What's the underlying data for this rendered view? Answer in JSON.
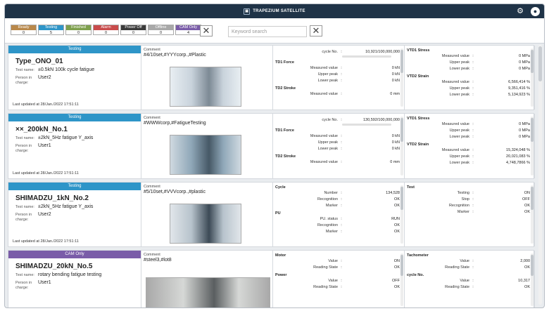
{
  "app": {
    "title": "TRAPEZIUM SATELLITE"
  },
  "filters": [
    {
      "label": "Ready",
      "count": "0",
      "color": "#b9884a"
    },
    {
      "label": "Testing",
      "count": "5",
      "color": "#2e95c8"
    },
    {
      "label": "Finished",
      "count": "0",
      "color": "#7ea04d"
    },
    {
      "label": "Alarm",
      "count": "0",
      "color": "#c94b4b"
    },
    {
      "label": "Power Off",
      "count": "0",
      "color": "#3b3b3b"
    },
    {
      "label": "Offline",
      "count": "0",
      "color": "#a8a8a8"
    },
    {
      "label": "CAM Only",
      "count": "4",
      "color": "#7a5ca8"
    }
  ],
  "search": {
    "placeholder": "Keyword search"
  },
  "cards": [
    {
      "status": "Testing",
      "status_color": "#2e95c8",
      "name": "Type_ONO_01",
      "test_name_label": "Test name:",
      "test_name": "±0.5kN 100k cycle fatigue",
      "person_label": "Person in charge:",
      "person": "User2",
      "updated": "Last updated at  28/Jan./2022 17:51:11",
      "comment_label": "Comment",
      "comment": "#4/10set,#YYYcorp.,#Plastic",
      "m1_sections": [
        {
          "title": "",
          "rows": [
            {
              "name": "cycle No.",
              "value": "10,921/100,000,000"
            }
          ],
          "bar": true
        },
        {
          "title": "TD1 Force",
          "rows": [
            {
              "name": "Measured value",
              "value": "0 kN"
            },
            {
              "name": "Upper peak",
              "value": "0 kN"
            },
            {
              "name": "Lower peak",
              "value": "0 kN"
            }
          ]
        },
        {
          "title": "TD2 Stroke",
          "rows": [
            {
              "name": "Measured value",
              "value": "0 mm"
            }
          ]
        }
      ],
      "m2_sections": [
        {
          "title": "VTD1 Stress",
          "rows": [
            {
              "name": "Measured value",
              "value": "0 MPa"
            },
            {
              "name": "Upper peak",
              "value": "0 MPa"
            },
            {
              "name": "Lower peak",
              "value": "0 MPa"
            }
          ]
        },
        {
          "title": "VTD2 Strain",
          "rows": [
            {
              "name": "Measured value",
              "value": "6,566,414 %"
            },
            {
              "name": "Upper peak",
              "value": "9,351,416 %"
            },
            {
              "name": "Lower peak",
              "value": "5,134,923 %"
            }
          ]
        }
      ]
    },
    {
      "status": "Testing",
      "status_color": "#2e95c8",
      "name": "××_200kN_No.1",
      "test_name_label": "Test name:",
      "test_name": "±2kN_5Hz fatigue Y_axis",
      "person_label": "Person in charge:",
      "person": "User1",
      "updated": "Last updated at  28/Jan./2022 17:51:11",
      "comment_label": "Comment",
      "comment": "#WWWcorp,#FatigueTesting",
      "m1_sections": [
        {
          "title": "",
          "rows": [
            {
              "name": "cycle No.",
              "value": "130,592/100,000,000"
            }
          ],
          "bar": true
        },
        {
          "title": "TD1 Force",
          "rows": [
            {
              "name": "Measured value",
              "value": "0 kN"
            },
            {
              "name": "Upper peak",
              "value": "0 kN"
            },
            {
              "name": "Lower peak",
              "value": "0 kN"
            }
          ]
        },
        {
          "title": "TD2 Stroke",
          "rows": [
            {
              "name": "Measured value",
              "value": "0 mm"
            }
          ]
        }
      ],
      "m2_sections": [
        {
          "title": "VTD1 Stress",
          "rows": [
            {
              "name": "Measured value",
              "value": "0 MPa"
            },
            {
              "name": "Upper peak",
              "value": "0 MPa"
            },
            {
              "name": "Lower peak",
              "value": "0 MPa"
            }
          ]
        },
        {
          "title": "VTD2 Strain",
          "rows": [
            {
              "name": "Measured value",
              "value": "15,324,048 %"
            },
            {
              "name": "Upper peak",
              "value": "20,021,083 %"
            },
            {
              "name": "Lower peak",
              "value": "4,748,7866 %"
            }
          ]
        }
      ]
    },
    {
      "status": "Testing",
      "status_color": "#2e95c8",
      "name": "SHIMADZU_1kN_No.2",
      "test_name_label": "Test name:",
      "test_name": "±2kN_5Hz fatigue Y_axis",
      "person_label": "Person in charge:",
      "person": "User2",
      "updated": "Last updated at  28/Jan./2022 17:51:11",
      "comment_label": "Comment",
      "comment": "#5/10set,#VVVcorp.,#plastic",
      "m1_sections": [
        {
          "title": "Cycle",
          "rows": [
            {
              "name": "Number",
              "value": "134,528"
            },
            {
              "name": "Recognition",
              "value": "OK"
            },
            {
              "name": "Marker",
              "value": "OK"
            }
          ]
        },
        {
          "title": "PU",
          "rows": [
            {
              "name": "PU. status",
              "value": "RUN"
            },
            {
              "name": "Recognition",
              "value": "OK"
            },
            {
              "name": "Marker",
              "value": "OK"
            }
          ]
        }
      ],
      "m2_sections": [
        {
          "title": "Test",
          "rows": [
            {
              "name": "Testing",
              "value": "ON"
            },
            {
              "name": "Stop",
              "value": "OFF"
            },
            {
              "name": "Recognition",
              "value": "OK"
            },
            {
              "name": "Marker",
              "value": "OK"
            }
          ]
        }
      ]
    },
    {
      "status": "CAM Only",
      "status_color": "#7a5ca8",
      "name": "SHIMADZU_20kN_No.5",
      "test_name_label": "Test name:",
      "test_name": "rotary bending fatigue testing",
      "person_label": "Person in charge:",
      "person": "User1",
      "updated": "",
      "comment_label": "Comment",
      "comment": "#steel3,#lot8",
      "m1_sections": [
        {
          "title": "Motor",
          "rows": [
            {
              "name": "Value",
              "value": "ON"
            },
            {
              "name": "Reading State",
              "value": "OK"
            }
          ]
        },
        {
          "title": "Power",
          "rows": [
            {
              "name": "Value",
              "value": "OFF"
            },
            {
              "name": "Reading State",
              "value": "OK"
            }
          ]
        }
      ],
      "m2_sections": [
        {
          "title": "Tachometer",
          "rows": [
            {
              "name": "Value",
              "value": "2,000"
            },
            {
              "name": "Reading State",
              "value": "OK"
            }
          ]
        },
        {
          "title": "cycle No.",
          "rows": [
            {
              "name": "Value",
              "value": "10,317"
            },
            {
              "name": "Reading State",
              "value": "OK"
            }
          ]
        }
      ]
    }
  ]
}
